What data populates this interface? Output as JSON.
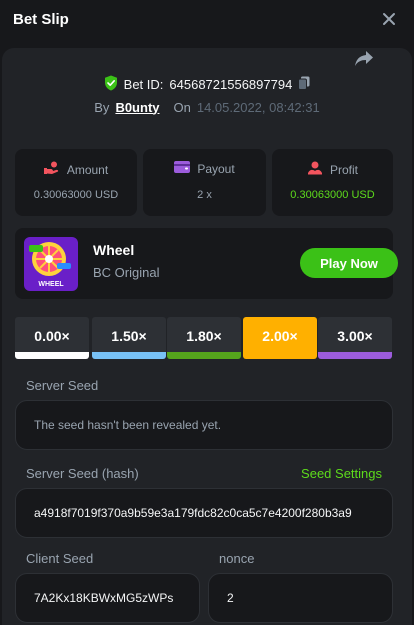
{
  "header": {
    "title": "Bet Slip"
  },
  "bet": {
    "id_label": "Bet ID:",
    "id": "64568721556897794",
    "by_label": "By",
    "user": "B0unty",
    "on_label": "On",
    "date": "14.05.2022, 08:42:31"
  },
  "stats": {
    "amount": {
      "label": "Amount",
      "value": "0.30063000 USD"
    },
    "payout": {
      "label": "Payout",
      "value": "2 x"
    },
    "profit": {
      "label": "Profit",
      "value": "0.30063000 USD"
    }
  },
  "game": {
    "name": "Wheel",
    "subtitle": "BC Original",
    "play_label": "Play Now",
    "thumb_text": "WHEEL"
  },
  "multipliers": [
    {
      "label": "0.00×",
      "color": "#ffffff",
      "selected": false
    },
    {
      "label": "1.50×",
      "color": "#78c1f5",
      "selected": false
    },
    {
      "label": "1.80×",
      "color": "#55a51c",
      "selected": false
    },
    {
      "label": "2.00×",
      "color": "#ffb000",
      "selected": true
    },
    {
      "label": "3.00×",
      "color": "#9c5cdc",
      "selected": false
    }
  ],
  "seeds": {
    "server_seed_label": "Server Seed",
    "server_seed_value": "The seed hasn't been revealed yet.",
    "server_hash_label": "Server Seed (hash)",
    "seed_settings_label": "Seed Settings",
    "server_hash_value": "a4918f7019f370a9b59e3a179fdc82c0ca5c7e4200f280b3a9",
    "client_seed_label": "Client Seed",
    "client_seed_value": "7A2Kx18KBWxMG5zWPs",
    "nonce_label": "nonce",
    "nonce_value": "2"
  },
  "colors": {
    "background": "#17181b",
    "panel": "#212327",
    "accent_green": "#3bc117",
    "profit_green": "#5ddb1c",
    "selected_orange": "#ffb000"
  }
}
